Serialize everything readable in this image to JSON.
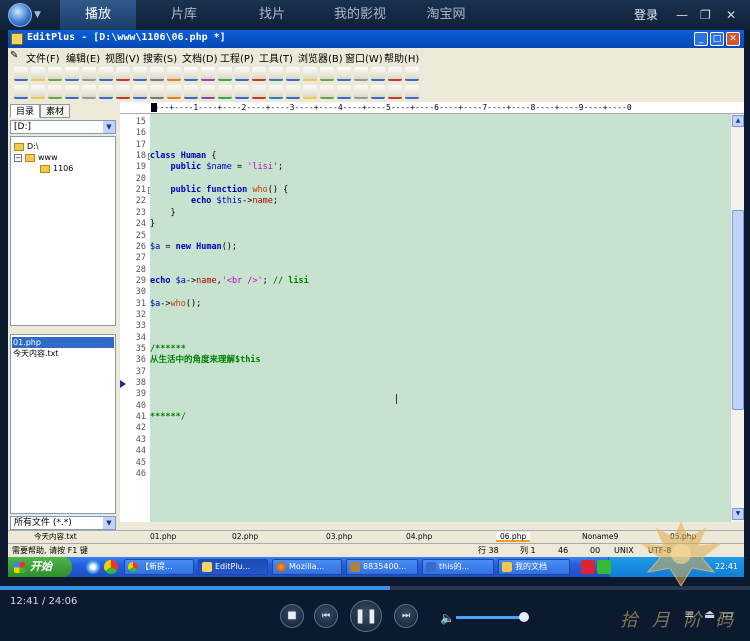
{
  "player": {
    "tabs": [
      "播放",
      "片库",
      "找片",
      "我的影视",
      "淘宝网"
    ],
    "login": "登录",
    "time": "12:41 / 24:06",
    "progress": 0.52,
    "volume": 0.95
  },
  "editplus": {
    "title": "EditPlus - [D:\\www\\1106\\06.php *]",
    "menu": [
      "文件(F)",
      "编辑(E)",
      "视图(V)",
      "搜索(S)",
      "文档(D)",
      "工程(P)",
      "工具(T)",
      "浏览器(B)",
      "窗口(W)",
      "帮助(H)"
    ],
    "left_tabs": [
      "目录",
      "素材"
    ],
    "drive": "[D:]",
    "tree": [
      "D:\\",
      "www",
      "1106"
    ],
    "files": [
      "01.php",
      "今天内容.txt"
    ],
    "file_filter": "所有文件 (*.*)",
    "ruler": "----+----1----+----2----+----3----+----4----+----5----+----6----+----7----+----8----+----9----+----0",
    "first_line": 15,
    "last_line": 46,
    "code": [
      {
        "n": 18,
        "segs": [
          [
            "kw",
            "class Human"
          ],
          [
            "",
            " {"
          ]
        ]
      },
      {
        "n": 19,
        "segs": [
          [
            "",
            "    "
          ],
          [
            "kw",
            "public"
          ],
          [
            "var",
            " $name"
          ],
          [
            "",
            " = "
          ],
          [
            "str",
            "'lisi'"
          ],
          [
            "",
            ";"
          ]
        ]
      },
      {
        "n": 21,
        "segs": [
          [
            "",
            "    "
          ],
          [
            "kw",
            "public function"
          ],
          [
            "fn",
            " who"
          ],
          [
            "",
            "() {"
          ]
        ]
      },
      {
        "n": 22,
        "segs": [
          [
            "",
            "        "
          ],
          [
            "kw",
            "echo"
          ],
          [
            "var",
            " $this"
          ],
          [
            "",
            "->"
          ],
          [
            "prop",
            "name"
          ],
          [
            "",
            ";"
          ]
        ]
      },
      {
        "n": 23,
        "segs": [
          [
            "",
            "    }"
          ]
        ]
      },
      {
        "n": 24,
        "segs": [
          [
            "",
            "}"
          ]
        ]
      },
      {
        "n": 26,
        "segs": [
          [
            "var",
            "$a"
          ],
          [
            "",
            " = "
          ],
          [
            "kw",
            "new"
          ],
          [
            "kw",
            " Human"
          ],
          [
            "",
            "();"
          ]
        ]
      },
      {
        "n": 29,
        "segs": [
          [
            "kw",
            "echo"
          ],
          [
            "var",
            " $a"
          ],
          [
            "",
            "->"
          ],
          [
            "prop",
            "name"
          ],
          [
            "",
            ","
          ],
          [
            "str",
            "'<br />'"
          ],
          [
            "",
            "; "
          ],
          [
            "cmt",
            "// lisi"
          ]
        ]
      },
      {
        "n": 31,
        "segs": [
          [
            "var",
            "$a"
          ],
          [
            "",
            "->"
          ],
          [
            "fn",
            "who"
          ],
          [
            "",
            "();"
          ]
        ]
      },
      {
        "n": 35,
        "segs": [
          [
            "cmt",
            "/******"
          ]
        ]
      },
      {
        "n": 36,
        "segs": [
          [
            "cmt",
            "从生活中的角度来理解$this"
          ]
        ]
      },
      {
        "n": 41,
        "segs": [
          [
            "cmt",
            "******/"
          ]
        ]
      }
    ],
    "doc_tabs": [
      "今天内容.txt",
      "01.php",
      "02.php",
      "03.php",
      "04.php",
      "06.php",
      "Noname9",
      "05.php"
    ],
    "active_doc_tab": 5,
    "status": {
      "help": "需要帮助, 请按 F1 键",
      "row": "行 38",
      "col": "列 1",
      "chars": "46",
      "mode": "00",
      "eol": "UNIX",
      "encoding": "UTF-8"
    }
  },
  "taskbar": {
    "start": "开始",
    "tasks": [
      "【新提...",
      "EditPlu...",
      "Mozilla...",
      "8835400...",
      "this的...",
      "我的文档"
    ],
    "clock": "22:41"
  },
  "watermark": "拾 月 阶 码"
}
